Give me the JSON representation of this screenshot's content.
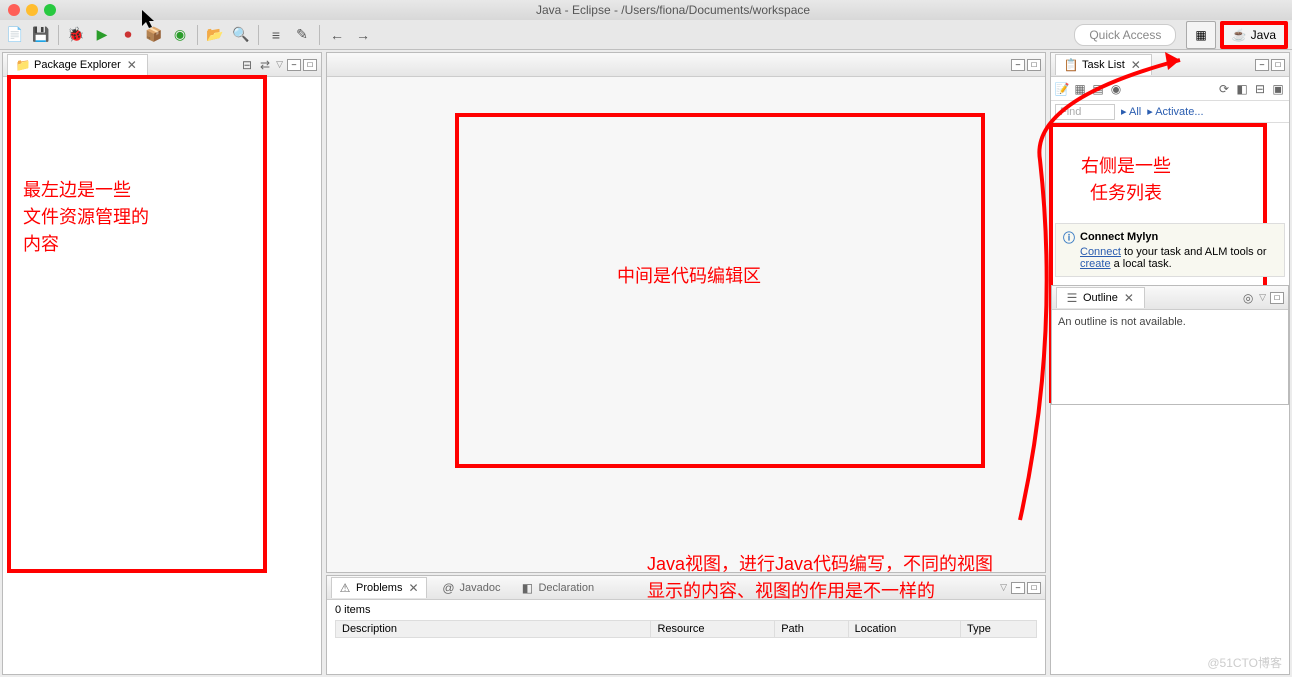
{
  "window": {
    "title": "Java - Eclipse - /Users/fiona/Documents/workspace"
  },
  "toolbar": {
    "quick_access": "Quick Access",
    "perspective_java": "Java"
  },
  "package_explorer": {
    "label": "Package Explorer",
    "close": "✕"
  },
  "task_list": {
    "label": "Task List",
    "find": "Find",
    "all": "All",
    "activate": "Activate...",
    "mylyn_title": "Connect Mylyn",
    "mylyn_text1": " to your task and ALM tools or ",
    "mylyn_text2": " a local task.",
    "connect": "Connect",
    "create": "create"
  },
  "outline": {
    "label": "Outline",
    "empty": "An outline is not available."
  },
  "problems": {
    "tab_problems": "Problems",
    "tab_javadoc": "Javadoc",
    "tab_declaration": "Declaration",
    "items": "0 items",
    "col_description": "Description",
    "col_resource": "Resource",
    "col_path": "Path",
    "col_location": "Location",
    "col_type": "Type"
  },
  "annotations": {
    "left": "最左边是一些\n文件资源管理的\n内容",
    "center": "中间是代码编辑区",
    "right": "右侧是一些\n任务列表",
    "bottom": "Java视图，进行Java代码编写，不同的视图\n显示的内容、视图的作用是不一样的"
  },
  "watermark": "@51CTO博客"
}
